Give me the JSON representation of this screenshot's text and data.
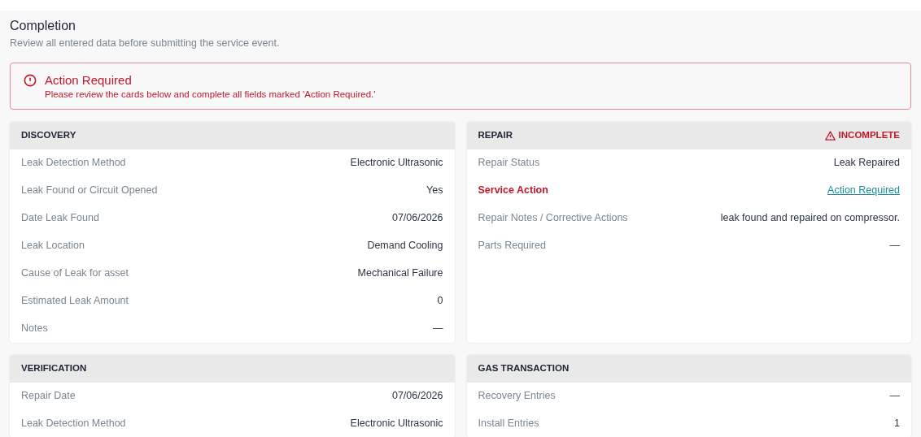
{
  "header": {
    "title": "Completion",
    "subtitle": "Review all entered data before submitting the service event."
  },
  "alert": {
    "title": "Action Required",
    "message": "Please review the cards below and complete all fields marked 'Action Required.'"
  },
  "cards": [
    {
      "title": "DISCOVERY",
      "rows": [
        {
          "label": "Leak Detection Method",
          "value": "Electronic Ultrasonic",
          "kind": "value"
        },
        {
          "label": "Leak Found or Circuit Opened",
          "value": "Yes",
          "kind": "value"
        },
        {
          "label": "Date Leak Found",
          "value": "07/06/2026",
          "kind": "value"
        },
        {
          "label": "Leak Location",
          "value": "Demand Cooling",
          "kind": "value"
        },
        {
          "label": "Cause of Leak for asset",
          "value": "Mechanical Failure",
          "kind": "value"
        },
        {
          "label": "Estimated Leak Amount",
          "value": "0",
          "kind": "value"
        },
        {
          "label": "Notes",
          "value": "—",
          "kind": "value"
        }
      ]
    },
    {
      "title": "REPAIR",
      "status": "INCOMPLETE",
      "rows": [
        {
          "label": "Repair Status",
          "value": "Leak Repaired",
          "kind": "value"
        },
        {
          "label": "Service Action",
          "value": "Action Required",
          "kind": "action"
        },
        {
          "label": "Repair Notes / Corrective Actions",
          "value": "leak found and repaired on compressor.",
          "kind": "value"
        },
        {
          "label": "Parts Required",
          "value": "—",
          "kind": "value"
        }
      ]
    },
    {
      "title": "VERIFICATION",
      "rows": [
        {
          "label": "Repair Date",
          "value": "07/06/2026",
          "kind": "value"
        },
        {
          "label": "Leak Detection Method",
          "value": "Electronic Ultrasonic",
          "kind": "value"
        }
      ]
    },
    {
      "title": "GAS TRANSACTION",
      "rows": [
        {
          "label": "Recovery Entries",
          "value": "—",
          "kind": "value"
        },
        {
          "label": "Install Entries",
          "value": "1",
          "kind": "value"
        }
      ]
    }
  ]
}
